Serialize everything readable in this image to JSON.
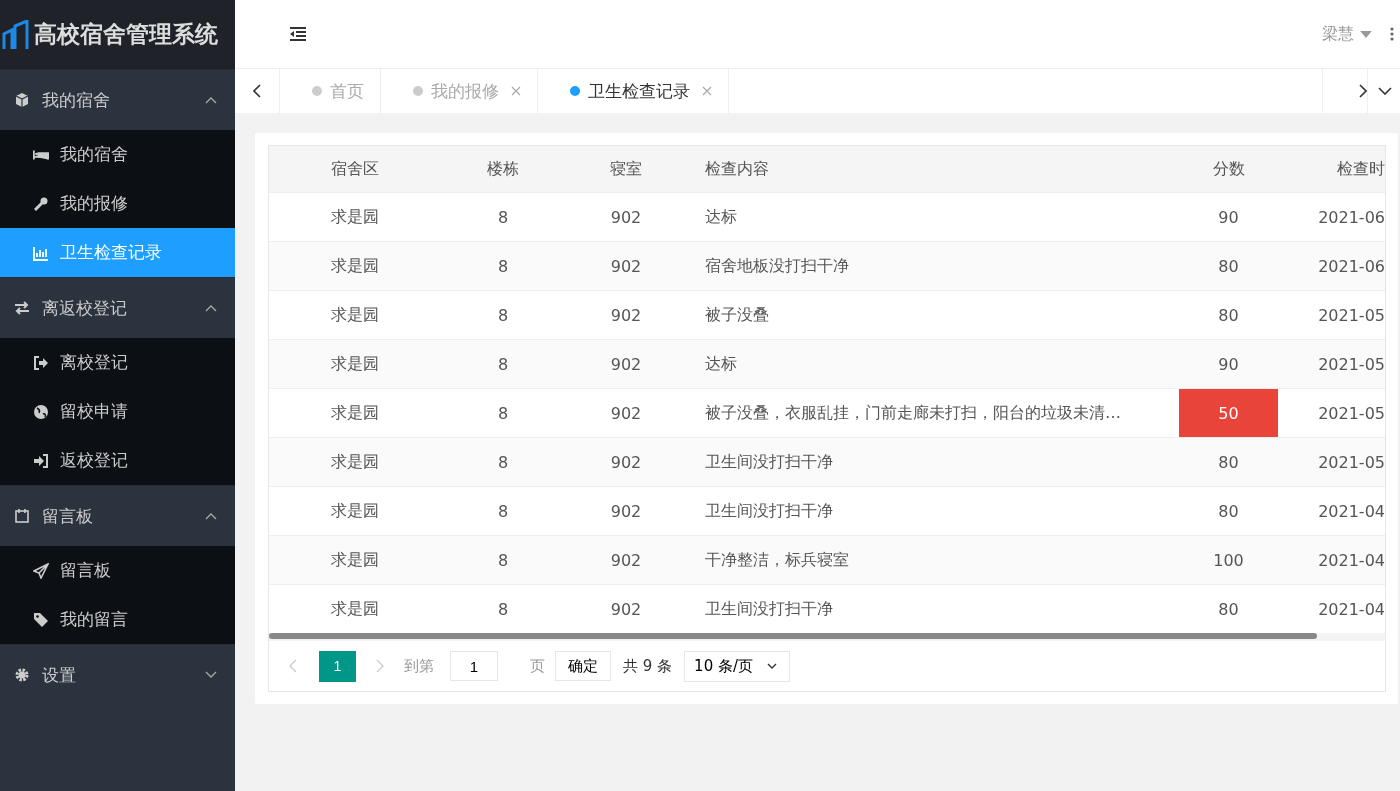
{
  "app_title": "高校宿舍管理系统",
  "sidebar": {
    "groups": [
      {
        "label": "我的宿舍",
        "expanded": true,
        "children": [
          {
            "label": "我的宿舍",
            "selected": false
          },
          {
            "label": "我的报修",
            "selected": false
          },
          {
            "label": "卫生检查记录",
            "selected": true
          }
        ]
      },
      {
        "label": "离返校登记",
        "expanded": true,
        "children": [
          {
            "label": "离校登记",
            "selected": false
          },
          {
            "label": "留校申请",
            "selected": false
          },
          {
            "label": "返校登记",
            "selected": false
          }
        ]
      },
      {
        "label": "留言板",
        "expanded": true,
        "children": [
          {
            "label": "留言板",
            "selected": false
          },
          {
            "label": "我的留言",
            "selected": false
          }
        ]
      },
      {
        "label": "设置",
        "expanded": false
      }
    ]
  },
  "user": {
    "name": "梁慧"
  },
  "tabs": [
    {
      "label": "首页",
      "selected": false,
      "closable": false
    },
    {
      "label": "我的报修",
      "selected": false,
      "closable": true
    },
    {
      "label": "卫生检查记录",
      "selected": true,
      "closable": true
    }
  ],
  "table": {
    "columns": [
      "宿舍区",
      "楼栋",
      "寝室",
      "检查内容",
      "分数",
      "检查时"
    ],
    "rows": [
      {
        "cells": [
          "求是园",
          "8",
          "902",
          "达标",
          "90",
          "2021-06"
        ],
        "flagged": false
      },
      {
        "cells": [
          "求是园",
          "8",
          "902",
          "宿舍地板没打扫干净",
          "80",
          "2021-06"
        ],
        "flagged": false
      },
      {
        "cells": [
          "求是园",
          "8",
          "902",
          "被子没叠",
          "80",
          "2021-05"
        ],
        "flagged": false
      },
      {
        "cells": [
          "求是园",
          "8",
          "902",
          "达标",
          "90",
          "2021-05"
        ],
        "flagged": false
      },
      {
        "cells": [
          "求是园",
          "8",
          "902",
          "被子没叠，衣服乱挂，门前走廊未打扫，阳台的垃圾未清…",
          "50",
          "2021-05"
        ],
        "flagged": true
      },
      {
        "cells": [
          "求是园",
          "8",
          "902",
          "卫生间没打扫干净",
          "80",
          "2021-05"
        ],
        "flagged": false
      },
      {
        "cells": [
          "求是园",
          "8",
          "902",
          "卫生间没打扫干净",
          "80",
          "2021-04"
        ],
        "flagged": false
      },
      {
        "cells": [
          "求是园",
          "8",
          "902",
          "干净整洁，标兵寝室",
          "100",
          "2021-04"
        ],
        "flagged": false
      },
      {
        "cells": [
          "求是园",
          "8",
          "902",
          "卫生间没打扫干净",
          "80",
          "2021-04"
        ],
        "flagged": false
      }
    ]
  },
  "pagination": {
    "pages": [
      {
        "label": "1",
        "selected": true
      }
    ],
    "goto_label": "到第",
    "page_input": "1",
    "page_suffix": "页",
    "confirm": "确定",
    "total": "共 9 条",
    "page_size": "10 条/页"
  }
}
